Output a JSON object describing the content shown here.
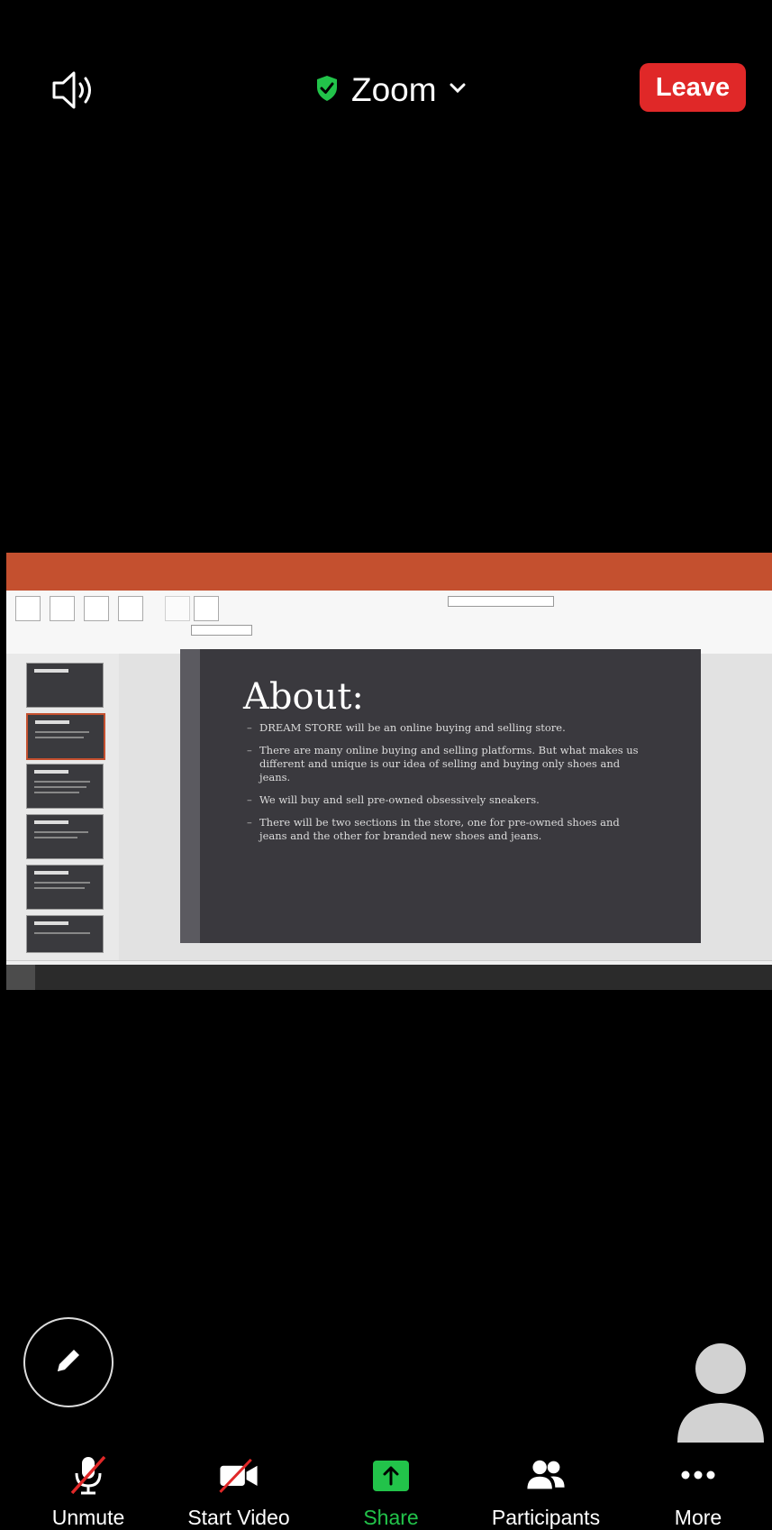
{
  "header": {
    "title": "Zoom",
    "leave_label": "Leave"
  },
  "icons": {
    "speaker": "speaker-icon",
    "shield": "shield-check-icon",
    "chevron": "chevron-down-icon",
    "pencil": "pencil-icon",
    "avatar": "user-avatar-icon"
  },
  "colors": {
    "leave": "#e02828",
    "shield": "#22c34a",
    "share": "#22c34a",
    "ppt_accent": "#c4502f"
  },
  "shared_screen": {
    "slide": {
      "title": "About:",
      "bullets": [
        "DREAM STORE will be an online buying and selling store.",
        "There are many online buying and selling platforms. But what makes us different and unique is our idea of selling and buying only shoes and jeans.",
        "We will buy and sell pre-owned obsessively sneakers.",
        "There will be two sections in the store, one for pre-owned shoes and jeans and the other for branded new shoes and jeans."
      ]
    }
  },
  "toolbar": {
    "items": [
      {
        "label": "Unmute",
        "icon": "mic-muted-icon"
      },
      {
        "label": "Start Video",
        "icon": "video-off-icon"
      },
      {
        "label": "Share",
        "icon": "share-icon"
      },
      {
        "label": "Participants",
        "icon": "participants-icon"
      },
      {
        "label": "More",
        "icon": "more-icon"
      }
    ]
  }
}
